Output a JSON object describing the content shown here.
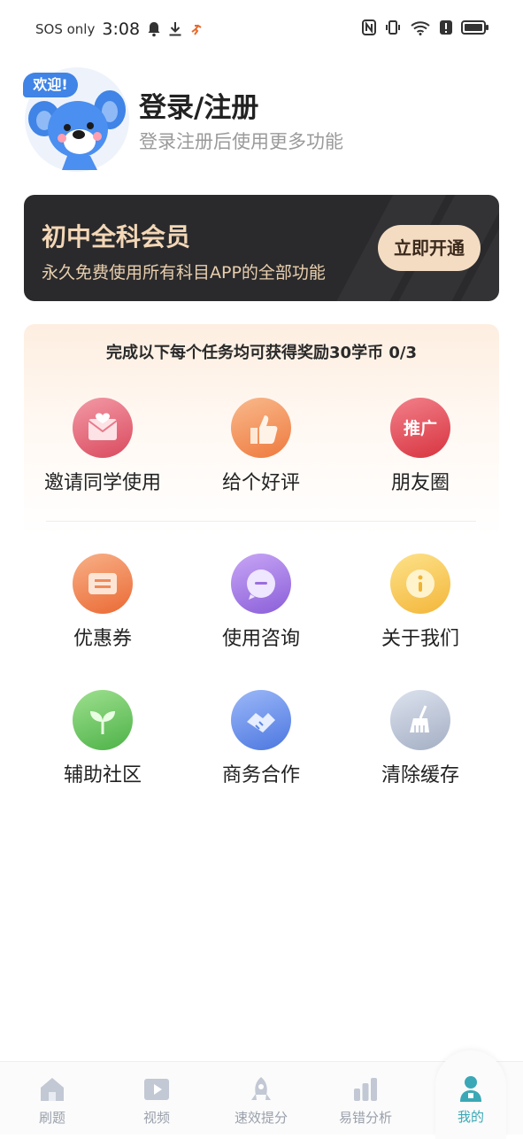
{
  "status_bar": {
    "carrier": "SOS only",
    "time": "3:08"
  },
  "profile": {
    "welcome_badge": "欢迎!",
    "title": "登录/注册",
    "subtitle": "登录注册后使用更多功能"
  },
  "vip": {
    "title": "初中全科会员",
    "subtitle": "永久免费使用所有科目APP的全部功能",
    "button": "立即开通"
  },
  "tasks": {
    "title": "完成以下每个任务均可获得奖励30学币 0/3",
    "items": [
      {
        "label": "邀请同学使用",
        "icon": "invite-envelope-icon",
        "color": "#e2596d"
      },
      {
        "label": "给个好评",
        "icon": "thumbs-up-icon",
        "color": "#f08a52"
      },
      {
        "label": "朋友圈",
        "icon": "promote-icon",
        "color": "#e0474f",
        "icon_text": "推广"
      }
    ]
  },
  "menu": {
    "items": [
      {
        "label": "优惠券",
        "icon": "coupon-icon",
        "color": "#ef7a3f"
      },
      {
        "label": "使用咨询",
        "icon": "chat-bubble-icon",
        "color": "#9a6ee0"
      },
      {
        "label": "关于我们",
        "icon": "info-icon",
        "color": "#f5c141"
      },
      {
        "label": "辅助社区",
        "icon": "sprout-icon",
        "color": "#5ec15a"
      },
      {
        "label": "商务合作",
        "icon": "handshake-icon",
        "color": "#5c87e8"
      },
      {
        "label": "清除缓存",
        "icon": "broom-icon",
        "color": "#a9b4c8"
      }
    ]
  },
  "bottom_nav": {
    "items": [
      {
        "label": "刷题",
        "icon": "home-icon"
      },
      {
        "label": "视频",
        "icon": "video-icon"
      },
      {
        "label": "速效提分",
        "icon": "rocket-icon"
      },
      {
        "label": "易错分析",
        "icon": "bar-chart-icon"
      },
      {
        "label": "我的",
        "icon": "user-icon",
        "active": true
      }
    ],
    "active_color": "#3aa8b6",
    "inactive_color": "#c2c8d4"
  }
}
